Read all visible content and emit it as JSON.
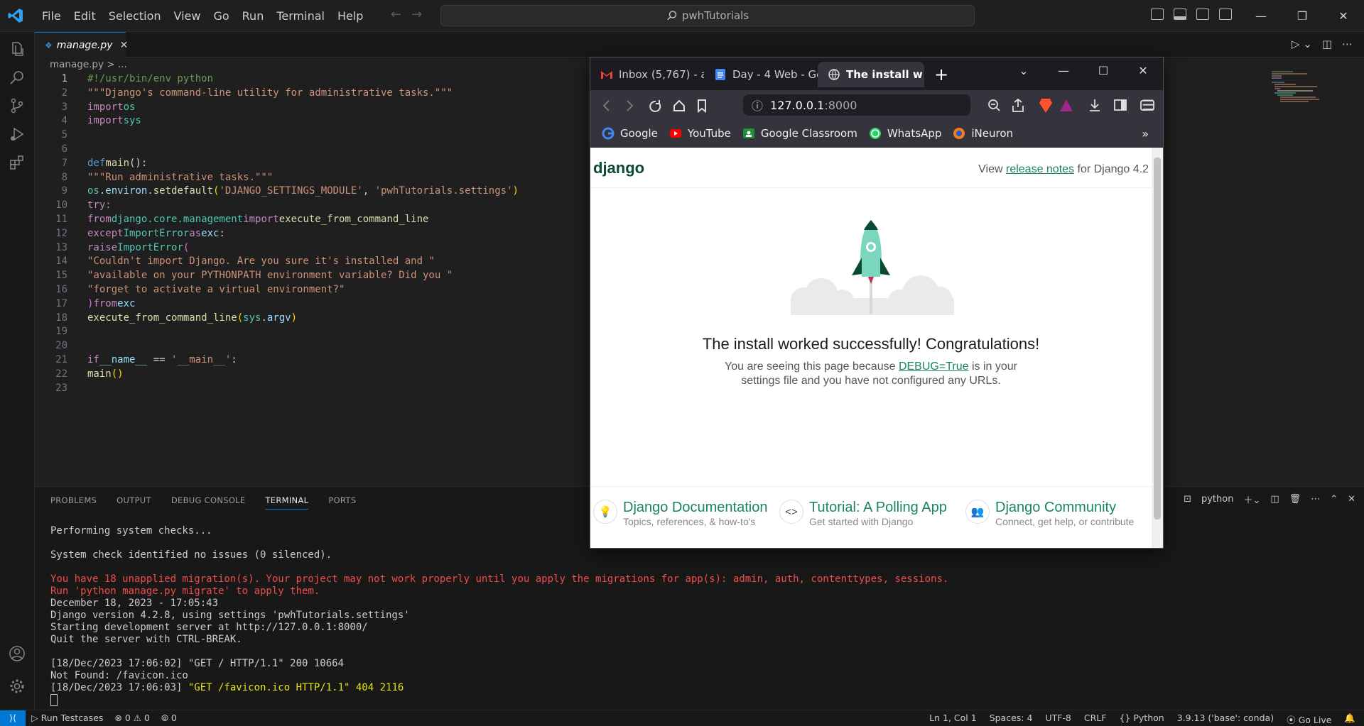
{
  "titlebar": {
    "menu": [
      "File",
      "Edit",
      "Selection",
      "View",
      "Go",
      "Run",
      "Terminal",
      "Help"
    ],
    "search": "pwhTutorials"
  },
  "editor": {
    "tab_label": "manage.py",
    "breadcrumb": "manage.py > ...",
    "line_numbers": [
      "1",
      "2",
      "3",
      "4",
      "5",
      "6",
      "7",
      "8",
      "9",
      "10",
      "11",
      "12",
      "13",
      "14",
      "15",
      "16",
      "17",
      "18",
      "19",
      "20",
      "21",
      "22",
      "23"
    ],
    "code": {
      "l1": "#!/usr/bin/env python",
      "l2": "\"\"\"Django's command-line utility for administrative tasks.\"\"\"",
      "l3_kw": "import",
      "l3_mod": "os",
      "l4_kw": "import",
      "l4_mod": "sys",
      "l7_def": "def",
      "l7_fn": "main",
      "l7_rest": "():",
      "l8": "\"\"\"Run administrative tasks.\"\"\"",
      "l9_a": "os",
      "l9_b": ".",
      "l9_c": "environ",
      "l9_d": ".",
      "l9_e": "setdefault",
      "l9_f": "(",
      "l9_g": "'DJANGO_SETTINGS_MODULE'",
      "l9_h": ", ",
      "l9_i": "'pwhTutorials.settings'",
      "l9_j": ")",
      "l10": "try:",
      "l11_kw": "from",
      "l11_mod": "django.core.management",
      "l11_kw2": "import",
      "l11_fn": "execute_from_command_line",
      "l12_kw": "except",
      "l12_cls": "ImportError",
      "l12_as": "as",
      "l12_var": "exc",
      "l12_end": ":",
      "l13_kw": "raise",
      "l13_cls": "ImportError",
      "l13_p": "(",
      "l14": "\"Couldn't import Django. Are you sure it's installed and \"",
      "l15": "\"available on your PYTHONPATH environment variable? Did you \"",
      "l16": "\"forget to activate a virtual environment?\"",
      "l17_p": ")",
      "l17_kw": "from",
      "l17_var": "exc",
      "l18_fn": "execute_from_command_line",
      "l18_p": "(",
      "l18_a": "sys",
      "l18_b": ".",
      "l18_c": "argv",
      "l18_e": ")",
      "l21_kw": "if",
      "l21_a": "__name__",
      "l21_op": " == ",
      "l21_s": "'__main__'",
      "l21_e": ":",
      "l22_fn": "main",
      "l22_p": "()"
    }
  },
  "panel": {
    "tabs": [
      "PROBLEMS",
      "OUTPUT",
      "DEBUG CONSOLE",
      "TERMINAL",
      "PORTS"
    ],
    "terminal_profile": "python",
    "terminal_lines": [
      {
        "c": "norm",
        "t": "Performing system checks..."
      },
      {
        "c": "norm",
        "t": ""
      },
      {
        "c": "norm",
        "t": "System check identified no issues (0 silenced)."
      },
      {
        "c": "norm",
        "t": ""
      },
      {
        "c": "red",
        "t": "You have 18 unapplied migration(s). Your project may not work properly until you apply the migrations for app(s): admin, auth, contenttypes, sessions."
      },
      {
        "c": "red",
        "t": "Run 'python manage.py migrate' to apply them."
      },
      {
        "c": "norm",
        "t": "December 18, 2023 - 17:05:43"
      },
      {
        "c": "norm",
        "t": "Django version 4.2.8, using settings 'pwhTutorials.settings'"
      },
      {
        "c": "norm",
        "t": "Starting development server at http://127.0.0.1:8000/"
      },
      {
        "c": "norm",
        "t": "Quit the server with CTRL-BREAK."
      },
      {
        "c": "norm",
        "t": ""
      },
      {
        "c": "norm",
        "t": "[18/Dec/2023 17:06:02] \"GET / HTTP/1.1\" 200 10664"
      },
      {
        "c": "norm",
        "t": "Not Found: /favicon.ico"
      },
      {
        "c": "mixed",
        "t1": "[18/Dec/2023 17:06:03] ",
        "t2": "\"GET /favicon.ico HTTP/1.1\" 404 2116"
      }
    ]
  },
  "statusbar": {
    "run_testcases": "Run Testcases",
    "errors": "0",
    "warnings": "0",
    "ports": "0",
    "position": "Ln 1, Col 1",
    "spaces": "Spaces: 4",
    "encoding": "UTF-8",
    "eol": "CRLF",
    "language": "Python",
    "interpreter": "3.9.13 ('base': conda)",
    "golive": "Go Live"
  },
  "browser": {
    "tabs": [
      "Inbox (5,767) - al",
      "Day - 4 Web - Go",
      "The install w"
    ],
    "url_host": "127.0.0.1",
    "url_port": ":8000",
    "bookmarks": [
      "Google",
      "YouTube",
      "Google Classroom",
      "WhatsApp",
      "iNeuron"
    ],
    "more": "»",
    "page": {
      "logo": "django",
      "release_prefix": "View ",
      "release_link": "release notes",
      "release_suffix": " for Django 4.2",
      "title": "The install worked successfully! Congratulations!",
      "sub_prefix": "You are seeing this page because ",
      "sub_link": "DEBUG=True",
      "sub_suffix": " is in your settings file and you have not configured any URLs.",
      "cards": [
        {
          "title": "Django Documentation",
          "desc": "Topics, references, & how-to's"
        },
        {
          "title": "Tutorial: A Polling App",
          "desc": "Get started with Django"
        },
        {
          "title": "Django Community",
          "desc": "Connect, get help, or contribute"
        }
      ]
    }
  },
  "colors": {
    "accent": "#0078d4",
    "django_green": "#19865c",
    "django_dark": "#0c4b33"
  }
}
